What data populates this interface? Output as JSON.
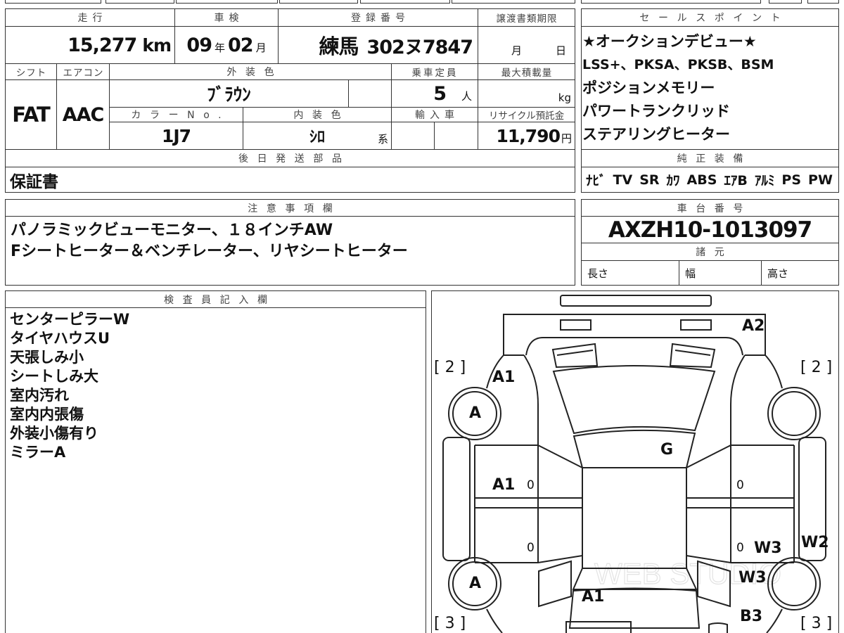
{
  "sheet": {
    "mileage": {
      "label": "走行",
      "value": "15,277",
      "unit": "km"
    },
    "inspection": {
      "label": "車検",
      "year": "09",
      "year_unit": "年",
      "month": "02",
      "month_unit": "月"
    },
    "registration": {
      "label": "登録番号",
      "area": "練馬",
      "number": "302ヌ7847"
    },
    "transfer_deadline": {
      "label": "譲渡書類期限",
      "month_unit": "月",
      "day_unit": "日"
    },
    "shift": {
      "label": "シフト",
      "value": "FAT"
    },
    "aircon": {
      "label": "エアコン",
      "value": "AAC"
    },
    "exterior_color": {
      "label": "外装色",
      "value": "ﾌﾞﾗｳﾝ"
    },
    "capacity": {
      "label": "乗車定員",
      "value": "5",
      "unit": "人"
    },
    "max_load": {
      "label": "最大積載量",
      "unit": "kg"
    },
    "color_no": {
      "label": "カラーNo.",
      "value": "1J7"
    },
    "interior_color": {
      "label": "内装色",
      "value": "ｼﾛ",
      "suffix": "系"
    },
    "import": {
      "label": "輸入車"
    },
    "recycle_fee": {
      "label": "リサイクル預託金",
      "value": "11,790",
      "unit": "円"
    },
    "later_parts": {
      "label": "後日発送部品",
      "value": "保証書"
    }
  },
  "sales_points": {
    "label": "セールスポイント",
    "lines": [
      "★オークションデビュー★",
      "LSS+、PKSA、PKSB、BSM",
      "ポジションメモリー",
      "パワートランクリッド",
      "ステアリングヒーター"
    ]
  },
  "equipment": {
    "label": "純正装備",
    "items": [
      "ﾅﾋﾞ",
      "TV",
      "SR",
      "ｶﾜ",
      "ABS",
      "ｴｱB",
      "ｱﾙﾐ",
      "PS",
      "PW"
    ]
  },
  "notes": {
    "label": "注意事項欄",
    "lines": [
      "パノラミックビューモニター、１８インチAW",
      "Fシートヒーター＆ベンチレーター、リヤシートヒーター"
    ]
  },
  "chassis": {
    "label": "車台番号",
    "value": "AXZH10-1013097"
  },
  "specs": {
    "label": "諸元",
    "length": "長さ",
    "width": "幅",
    "height": "高さ"
  },
  "inspector": {
    "label": "検査員記入欄",
    "lines": [
      "センターピラーW",
      "タイヤハウスU",
      "天張しみ小",
      "シートしみ大",
      "室内汚れ",
      "室内内張傷",
      "外装小傷有り",
      "ミラーA"
    ]
  },
  "diagram": {
    "front_bumper": "A2",
    "front_left_bracket": "[ 2 ]",
    "front_right_bracket": "[ 2 ]",
    "front_left_fender": "A1",
    "front_left_wheel": "A",
    "windshield": "G",
    "front_left_door": "A1",
    "front_left_door_count": "0",
    "front_right_door_count": "0",
    "rear_left_door_count": "0",
    "rear_right_door_count": "0",
    "rear_right_door": "W3",
    "right_side_panel": "W2",
    "rear_left_wheel": "A",
    "rear_right_fender": "W3",
    "trunk": "A1",
    "rear_right_bumper": "B3",
    "rear_left_bracket": "[ 3 ]",
    "rear_right_bracket": "[ 3 ]",
    "watermark": "WEB STUDIO"
  }
}
